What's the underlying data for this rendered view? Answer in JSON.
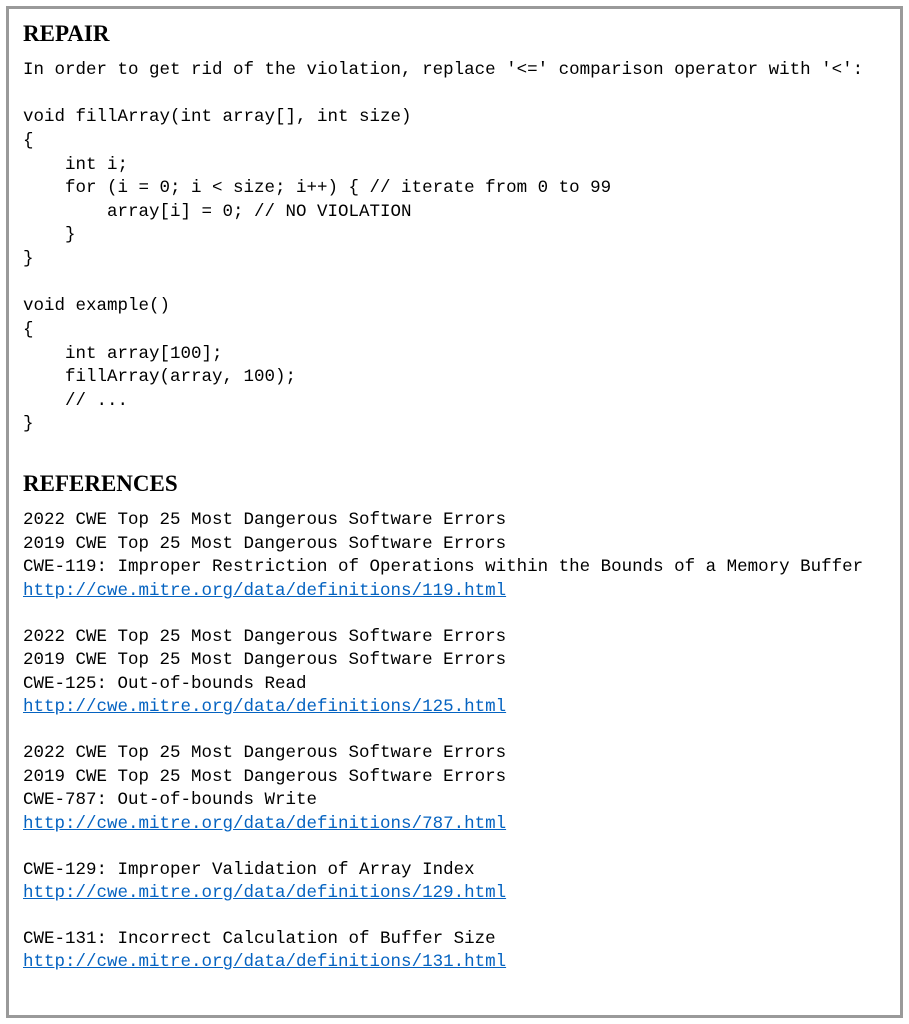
{
  "repair": {
    "heading": "REPAIR",
    "intro": "In order to get rid of the violation, replace '<=' comparison operator with '<':",
    "code": "void fillArray(int array[], int size)\n{\n    int i;\n    for (i = 0; i < size; i++) { // iterate from 0 to 99\n        array[i] = 0; // NO VIOLATION\n    }\n}\n\nvoid example()\n{\n    int array[100];\n    fillArray(array, 100);\n    // ...\n}"
  },
  "references": {
    "heading": "REFERENCES",
    "blocks": [
      {
        "lines": [
          "2022 CWE Top 25 Most Dangerous Software Errors",
          "2019 CWE Top 25 Most Dangerous Software Errors",
          "CWE-119: Improper Restriction of Operations within the Bounds of a Memory Buffer"
        ],
        "link": "http://cwe.mitre.org/data/definitions/119.html"
      },
      {
        "lines": [
          "2022 CWE Top 25 Most Dangerous Software Errors",
          "2019 CWE Top 25 Most Dangerous Software Errors",
          "CWE-125: Out-of-bounds Read"
        ],
        "link": "http://cwe.mitre.org/data/definitions/125.html"
      },
      {
        "lines": [
          "2022 CWE Top 25 Most Dangerous Software Errors",
          "2019 CWE Top 25 Most Dangerous Software Errors",
          "CWE-787: Out-of-bounds Write"
        ],
        "link": "http://cwe.mitre.org/data/definitions/787.html"
      },
      {
        "lines": [
          "CWE-129: Improper Validation of Array Index"
        ],
        "link": "http://cwe.mitre.org/data/definitions/129.html"
      },
      {
        "lines": [
          "CWE-131: Incorrect Calculation of Buffer Size"
        ],
        "link": "http://cwe.mitre.org/data/definitions/131.html"
      }
    ]
  }
}
